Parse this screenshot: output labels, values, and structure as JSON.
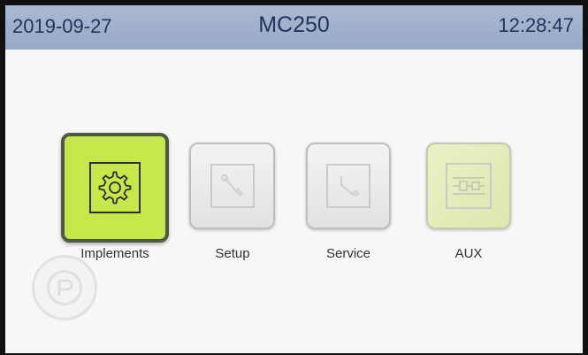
{
  "header": {
    "date": "2019-09-27",
    "title": "MC250",
    "time": "12:28:47"
  },
  "menu": {
    "items": [
      {
        "label": "Implements",
        "icon": "gear-icon",
        "state": "selected"
      },
      {
        "label": "Setup",
        "icon": "wrench-icon",
        "state": "normal"
      },
      {
        "label": "Service",
        "icon": "wrench-icon",
        "state": "normal"
      },
      {
        "label": "AUX",
        "icon": "hydraulic-valve-icon",
        "state": "normal"
      }
    ]
  },
  "colors": {
    "header_bg": "#a9b8d2",
    "header_text": "#20345f",
    "active_button": "#c6e84a",
    "screen_bg": "#f7f7f7"
  }
}
